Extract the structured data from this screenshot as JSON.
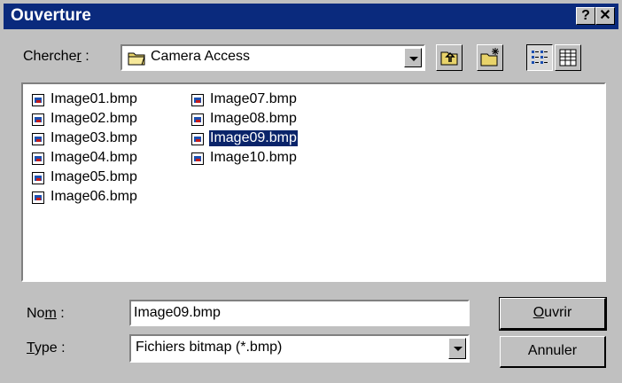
{
  "window": {
    "title": "Ouverture",
    "help_label": "?",
    "close_label": "✕"
  },
  "lookin": {
    "label_pre": "Cherche",
    "label_accel": "r",
    "label_post": " :",
    "value": "Camera Access",
    "folder_icon": "folder-icon"
  },
  "toolbar": {
    "up_icon": "folder-up-icon",
    "new_folder_icon": "new-folder-icon",
    "list_icon": "list-view-icon",
    "details_icon": "details-view-icon"
  },
  "files": [
    {
      "name": "Image01.bmp",
      "selected": false
    },
    {
      "name": "Image02.bmp",
      "selected": false
    },
    {
      "name": "Image03.bmp",
      "selected": false
    },
    {
      "name": "Image04.bmp",
      "selected": false
    },
    {
      "name": "Image05.bmp",
      "selected": false
    },
    {
      "name": "Image06.bmp",
      "selected": false
    },
    {
      "name": "Image07.bmp",
      "selected": false
    },
    {
      "name": "Image08.bmp",
      "selected": false
    },
    {
      "name": "Image09.bmp",
      "selected": true
    },
    {
      "name": "Image10.bmp",
      "selected": false
    }
  ],
  "filename": {
    "label_pre": "No",
    "label_accel": "m",
    "label_post": " :",
    "value": "Image09.bmp"
  },
  "filetype": {
    "label_accel": "T",
    "label_post": "ype :",
    "value": "Fichiers bitmap (*.bmp)"
  },
  "buttons": {
    "open_accel": "O",
    "open_rest": "uvrir",
    "cancel": "Annuler"
  }
}
